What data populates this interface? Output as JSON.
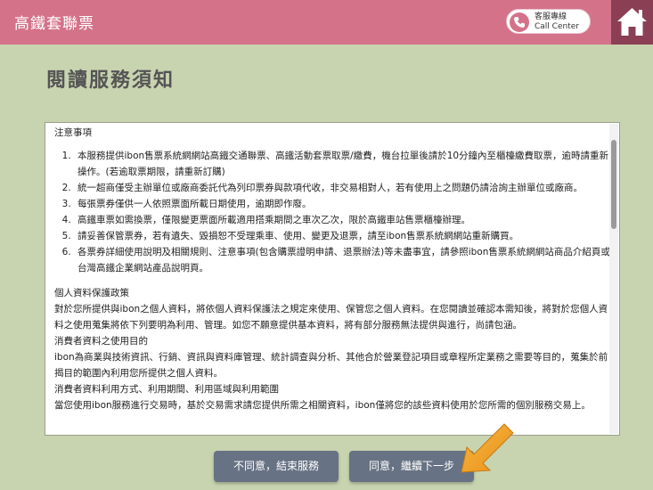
{
  "header": {
    "title": "高鐵套聯票",
    "call_center_cn": "客服專線",
    "call_center_en": "Call Center"
  },
  "page": {
    "title": "閱讀服務須知"
  },
  "notice": {
    "heading": "注意事項",
    "items": [
      "本服務提供ibon售票系統網網站高鐵交通聯票、高鐵活動套票取票/繳費，機台拉單後請於10分鐘內至櫃檯繳費取票，逾時請重新操作。(若逾取票期限，請重新訂購)",
      "統一超商僅受主辦單位或廠商委託代為列印票券與款項代收，非交易相對人，若有使用上之問題仍請洽詢主辦單位或廠商。",
      "每張票券僅供一人依照票面所載日期使用，逾期即作廢。",
      "高鐵車票如需換票，僅限變更票面所載適用搭乘期間之車次乙次，限於高鐵車站售票櫃檯辦理。",
      "請妥善保管票券，若有遺失、毀損恕不受理乘車、使用、變更及退票，請至ibon售票系統網網站重新購買。",
      "各票券詳細使用說明及相關規則、注意事項(包含購票證明申請、退票辦法)等未盡事宜，請參照ibon售票系統網網站商品介紹頁或台灣高鐵企業網站產品說明頁。"
    ]
  },
  "privacy": {
    "heading": "個人資料保護政策",
    "body": "對於您所提供與ibon之個人資料，將依個人資料保護法之規定來使用、保管您之個人資料。在您閱讀並確認本需知後，將對於您個人資料之使用蒐集將依下列要明為利用、管理。如您不願意提供基本資料，將有部分服務無法提供與進行，尚請包涵。",
    "purpose_heading": "消費者資料之使用目的",
    "purpose_body": "ibon為商業與技術資訊、行銷、資訊與資料庫管理、統計調查與分析、其他合於營業登記項目或章程所定業務之需要等目的，蒐集於前揭目的範圍內利用您所提供之個人資料。",
    "usage_heading": "消費者資料利用方式、利用期間、利用區域與利用範圍",
    "usage_body": "當您使用ibon服務進行交易時，基於交易需求請您提供所需之相關資料，ibon僅將您的該些資料使用於您所需的個別服務交易上。"
  },
  "buttons": {
    "decline": "不同意，結束服務",
    "agree": "同意，繼續下一步"
  },
  "colors": {
    "header_bg": "#d4728a",
    "home_bg": "#8b3f55",
    "page_bg": "#c8d4b0",
    "button_bg": "#677284",
    "pointer": "#f0a020"
  }
}
